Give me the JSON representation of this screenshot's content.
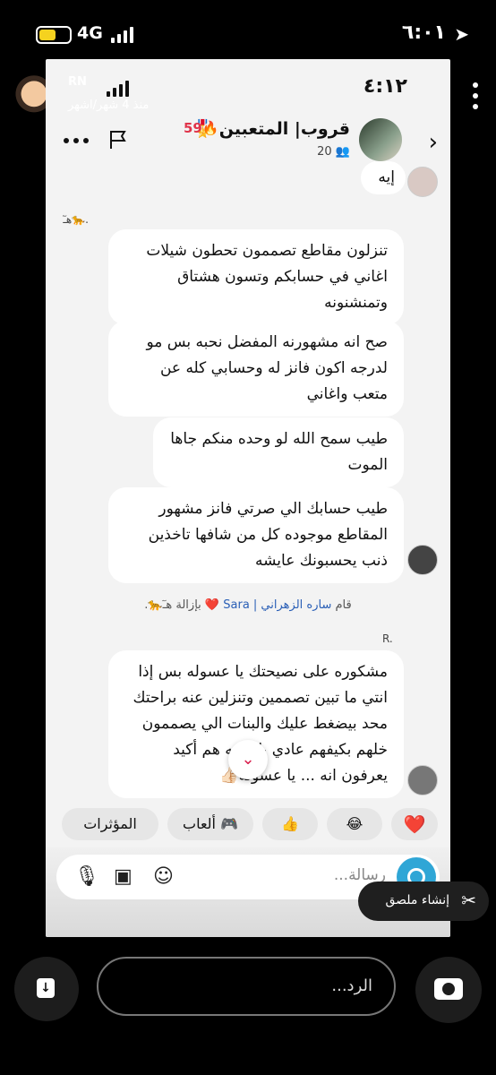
{
  "status_bar": {
    "time": "٦:٠١",
    "network": "4G"
  },
  "story": {
    "username": "RN",
    "time_ago": "منذ 4 شهر/اشهر"
  },
  "inner_status": {
    "time": "٤:١٢"
  },
  "chat": {
    "group_name": "قروب| المتعبين 🎖️",
    "streak": "59🔥",
    "members": "20"
  },
  "messages": {
    "m1": "إيه",
    "sender_a": "هـٓ🐆.",
    "m2": "تنزلون مقاطع تصممون تحطون شيلات اغاني في حسابكم وتسون هشتاق وتمنشنونه",
    "m3": "صح انه مشهورنه المفضل نحبه بس مو لدرجه اكون فانز له وحسابي كله عن متعب واغاني",
    "m4": "طيب سمح الله لو وحده منكم جاها الموت",
    "m5": "طيب حسابك الي صرتي فانز مشهور المقاطع موجوده كل من شافها تاخذين ذنب يحسبونك عايشه",
    "system": {
      "prefix": "قام",
      "actor": "ساره الزهراني | Sara ❤️",
      "suffix": "بإزالة هـٓ🐆."
    },
    "sender_b": "R.",
    "m6": "مشكوره على نصيحتك يا عسوله بس إذا انتي ما تبين تصممين وتنزلين عنه براحتك محد بيضغط عليك والبنات الي يصممون خلهم بكيفهم عادي بالنهايه هم أكيد يعرفون انه ... يا عسوله👍🏻"
  },
  "reactions": {
    "heart": "❤️",
    "laugh": "😂",
    "thumbs": "👍",
    "games": "ألعاب",
    "effects": "المؤثرات"
  },
  "input": {
    "placeholder": "رسالة..."
  },
  "sticker_tooltip": "إنشاء ملصق",
  "reply": {
    "placeholder": "الرد..."
  }
}
